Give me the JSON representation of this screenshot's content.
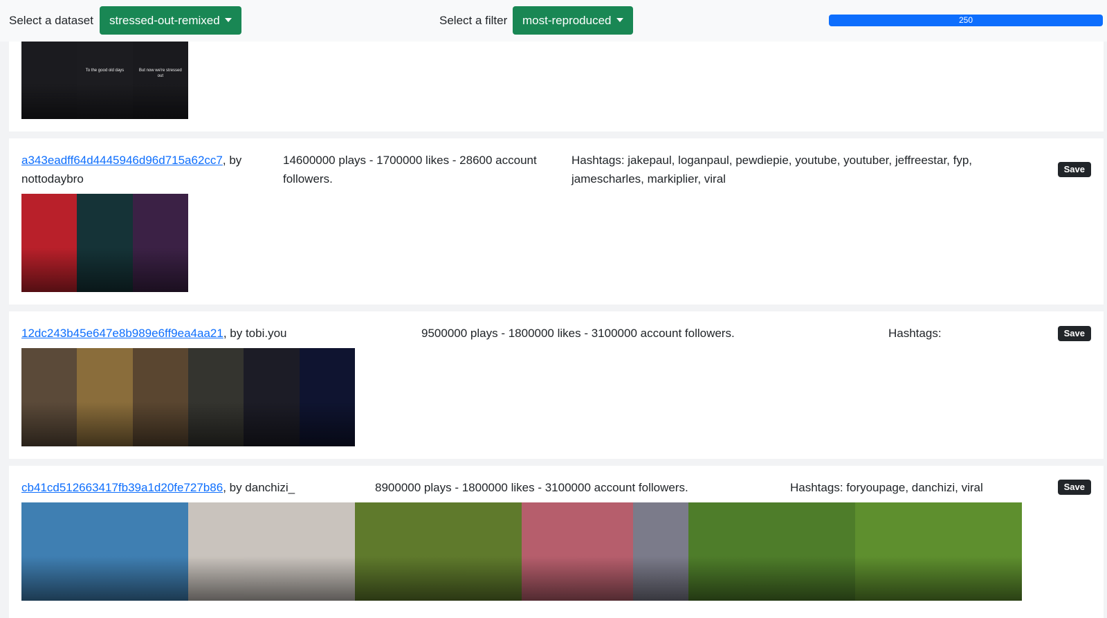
{
  "toolbar": {
    "dataset_label": "Select a dataset",
    "dataset_value": "stressed-out-remixed",
    "filter_label": "Select a filter",
    "filter_value": "most-reproduced",
    "progress_value": 250,
    "progress_label": "250",
    "accent_green": "#198754",
    "accent_blue": "#0d6efd"
  },
  "videos": [
    {
      "frames": [
        {
          "caption": "",
          "color": "#1b1b1f"
        },
        {
          "caption": "To the good old days",
          "color": "#1c1c20"
        },
        {
          "caption": "But now we're stressed out",
          "color": "#1a1a1e"
        }
      ]
    },
    {
      "id": "a343eadff64d4445946d96d715a62cc7",
      "by": ", by nottodaybro",
      "stats": "14600000 plays - 1700000 likes - 28600 account followers.",
      "hashtags": "Hashtags: jakepaul, loganpaul, pewdiepie, youtube, youtuber, jeffreestar, fyp, jamescharles, markiplier, viral",
      "save_label": "Save",
      "frames": [
        {
          "caption": "",
          "color": "#b9202a"
        },
        {
          "caption": "",
          "color": "#153337"
        },
        {
          "caption": "",
          "color": "#3b2145"
        }
      ]
    },
    {
      "id": "12dc243b45e647e8b989e6ff9ea4aa21",
      "by": ", by tobi.you",
      "stats": "9500000 plays - 1800000 likes - 3100000 account followers.",
      "hashtags": "Hashtags:",
      "save_label": "Save",
      "frames": [
        {
          "caption": "",
          "color": "#5b4a39"
        },
        {
          "caption": "",
          "color": "#8a6d3b"
        },
        {
          "caption": "",
          "color": "#5a4630"
        },
        {
          "caption": "",
          "color": "#34342f"
        },
        {
          "caption": "",
          "color": "#1c1c26"
        },
        {
          "caption": "",
          "color": "#0f1430"
        }
      ]
    },
    {
      "id": "cb41cd512663417fb39a1d20fe727b86",
      "by": ", by danchizi_",
      "stats": "8900000 plays - 1800000 likes - 3100000 account followers.",
      "hashtags": "Hashtags: foryoupage, danchizi, viral",
      "save_label": "Save",
      "frames": [
        {
          "caption": "",
          "color": "#3f7fb2"
        },
        {
          "caption": "",
          "color": "#3f7fb2"
        },
        {
          "caption": "",
          "color": "#3f7fb2"
        },
        {
          "caption": "",
          "color": "#c9c3bd"
        },
        {
          "caption": "",
          "color": "#c9c3bd"
        },
        {
          "caption": "",
          "color": "#c9c3bd"
        },
        {
          "caption": "",
          "color": "#5f7a2c"
        },
        {
          "caption": "",
          "color": "#5f7a2c"
        },
        {
          "caption": "",
          "color": "#5f7a2c"
        },
        {
          "caption": "",
          "color": "#b65e6c"
        },
        {
          "caption": "",
          "color": "#b65e6c"
        },
        {
          "caption": "",
          "color": "#7b7b8a"
        },
        {
          "caption": "",
          "color": "#4e7d2a"
        },
        {
          "caption": "",
          "color": "#4e7d2a"
        },
        {
          "caption": "",
          "color": "#4e7d2a"
        },
        {
          "caption": "",
          "color": "#5e8f2e"
        },
        {
          "caption": "",
          "color": "#5e8f2e"
        },
        {
          "caption": "",
          "color": "#5e8f2e"
        }
      ]
    }
  ]
}
